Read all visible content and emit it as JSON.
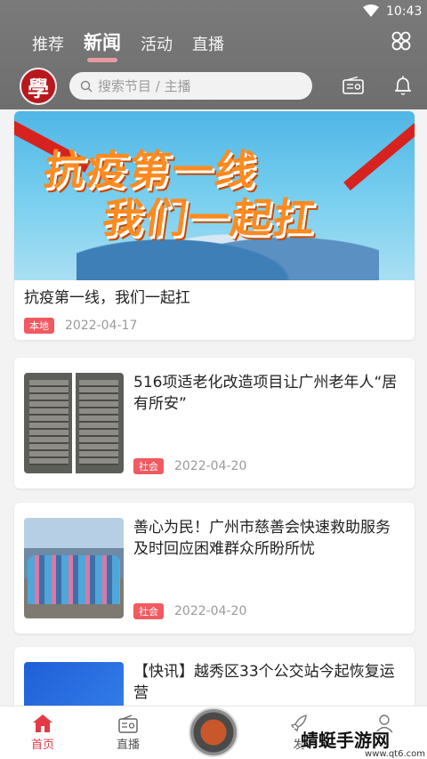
{
  "status": {
    "time": "10:43"
  },
  "tabs": [
    {
      "label": "推荐"
    },
    {
      "label": "新闻"
    },
    {
      "label": "活动"
    },
    {
      "label": "直播"
    }
  ],
  "header": {
    "logo_text": "學",
    "search_placeholder": "搜索节目 / 主播"
  },
  "featured": {
    "banner_line1": "抗疫第一线",
    "banner_line2": "我们一起扛",
    "title": "抗疫第一线，我们一起扛",
    "tag": "本地",
    "date": "2022-04-17"
  },
  "news": [
    {
      "title": "516项适老化改造项目让广州老年人“居有所安”",
      "tag": "社会",
      "date": "2022-04-20",
      "thumb": "stairs"
    },
    {
      "title": "善心为民！广州市慈善会快速救助服务及时回应困难群众所盼所忧",
      "tag": "社会",
      "date": "2022-04-20",
      "thumb": "medics"
    },
    {
      "title": "【快讯】越秀区33个公交站今起恢复运营",
      "tag": "",
      "date": "",
      "thumb": "blue"
    }
  ],
  "bottom_nav": [
    {
      "label": "首页",
      "icon": "home-icon",
      "active": true
    },
    {
      "label": "直播",
      "icon": "radio-icon"
    },
    {
      "label": "发",
      "icon": "rocket-icon"
    },
    {
      "label": "",
      "icon": "user-icon"
    }
  ],
  "watermark": {
    "text": "蜻蜓手游网",
    "url": "www.qt6.com"
  },
  "colors": {
    "accent": "#e33b45",
    "tag": "#f05a60",
    "topbar": "#727272"
  }
}
